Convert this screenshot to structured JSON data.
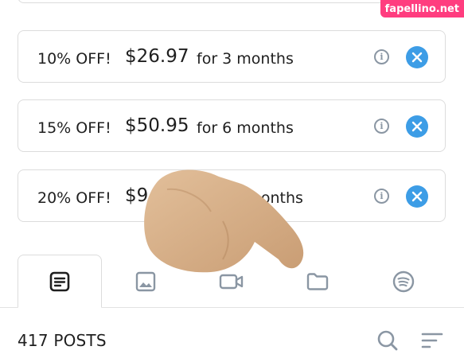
{
  "watermark": "fapellino.net",
  "bundles": [
    {
      "discount": "10% OFF!",
      "price": "$26.97",
      "duration": "for 3 months"
    },
    {
      "discount": "15% OFF!",
      "price": "$50.95",
      "duration": "for 6 months"
    },
    {
      "discount": "20% OFF!",
      "price": "$9",
      "duration": "for 12 months"
    }
  ],
  "tabs": [
    {
      "icon": "text-post-icon",
      "active": true
    },
    {
      "icon": "image-icon",
      "active": false
    },
    {
      "icon": "video-icon",
      "active": false
    },
    {
      "icon": "folder-icon",
      "active": false
    },
    {
      "icon": "spotify-icon",
      "active": false
    }
  ],
  "posts": {
    "count_label": "417 POSTS"
  },
  "colors": {
    "accent": "#3d9de6",
    "icon_gray": "#8a96a3",
    "border": "#dcdcdc",
    "watermark": "#ff3d7f"
  }
}
